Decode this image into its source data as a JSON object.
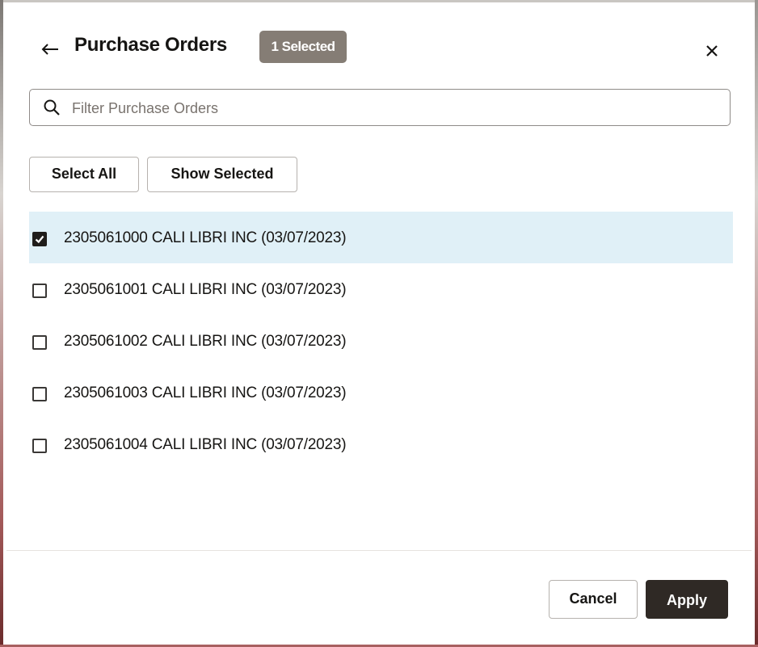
{
  "dialog": {
    "title": "Purchase Orders",
    "selected_badge": "1 Selected"
  },
  "search": {
    "placeholder": "Filter Purchase Orders"
  },
  "toolbar": {
    "select_all_label": "Select All",
    "show_selected_label": "Show Selected"
  },
  "purchase_orders": [
    {
      "label": "2305061000 CALI LIBRI INC (03/07/2023)",
      "checked": true
    },
    {
      "label": "2305061001 CALI LIBRI INC (03/07/2023)",
      "checked": false
    },
    {
      "label": "2305061002 CALI LIBRI INC (03/07/2023)",
      "checked": false
    },
    {
      "label": "2305061003 CALI LIBRI INC (03/07/2023)",
      "checked": false
    },
    {
      "label": "2305061004 CALI LIBRI INC (03/07/2023)",
      "checked": false
    }
  ],
  "footer": {
    "cancel_label": "Cancel",
    "apply_label": "Apply"
  },
  "icons": {
    "back": "arrow-left-icon",
    "close": "close-icon",
    "search": "search-icon",
    "checkbox_checked": "check-icon"
  },
  "colors": {
    "badge_bg": "#857d75",
    "selected_row_bg": "#e0f0f7",
    "primary_button_bg": "#2f2925"
  }
}
